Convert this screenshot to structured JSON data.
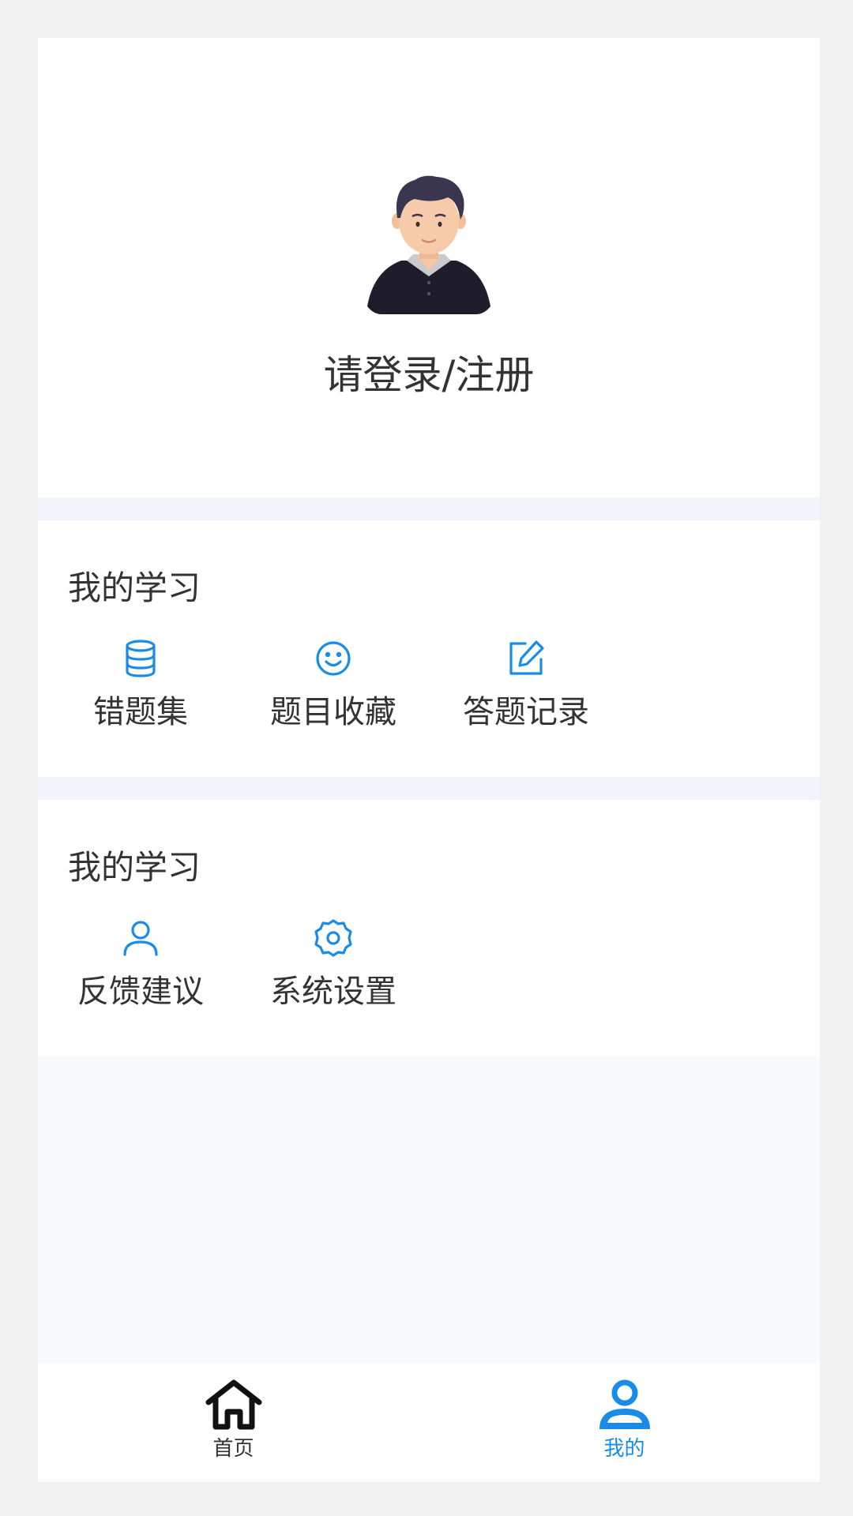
{
  "profile": {
    "login_label": "请登录/注册"
  },
  "study_section": {
    "title": "我的学习",
    "items": [
      {
        "label": "错题集",
        "icon": "database-icon"
      },
      {
        "label": "题目收藏",
        "icon": "smile-icon"
      },
      {
        "label": "答题记录",
        "icon": "edit-icon"
      }
    ]
  },
  "other_section": {
    "title": "我的学习",
    "items": [
      {
        "label": "反馈建议",
        "icon": "user-icon"
      },
      {
        "label": "系统设置",
        "icon": "settings-icon"
      }
    ]
  },
  "tabbar": {
    "tabs": [
      {
        "label": "首页",
        "icon": "home-icon",
        "active": false
      },
      {
        "label": "我的",
        "icon": "user-icon",
        "active": true
      }
    ]
  },
  "colors": {
    "accent": "#1a8ce8",
    "text": "#333333",
    "page_background": "#f1f1f1",
    "card_background": "#ffffff",
    "gap_band": "#f1f5fb"
  }
}
